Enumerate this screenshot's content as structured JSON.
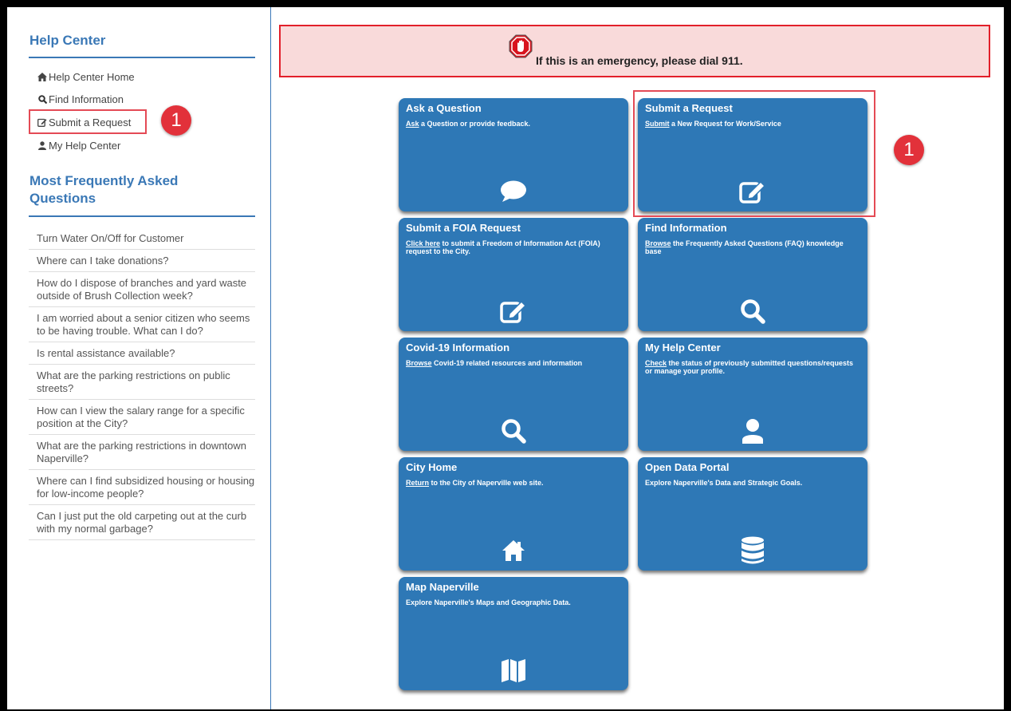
{
  "sidebar": {
    "title": "Help Center",
    "nav": [
      {
        "icon": "home-icon",
        "label": "Help Center Home"
      },
      {
        "icon": "search-icon",
        "label": "Find Information"
      },
      {
        "icon": "edit-icon",
        "label": "Submit a Request"
      },
      {
        "icon": "user-icon",
        "label": "My Help Center"
      }
    ],
    "badge": "1",
    "faq_title": "Most Frequently Asked Questions",
    "faq": [
      "Turn Water On/Off for Customer",
      "Where can I take donations?",
      "How do I dispose of branches and yard waste outside of Brush Collection week?",
      "I am worried about a senior citizen who seems to be having trouble. What can I do?",
      "Is rental assistance available?",
      "What are the parking restrictions on public streets?",
      "How can I view the salary range for a specific position at the City?",
      "What are the parking restrictions in downtown Naperville?",
      "Where can I find subsidized housing or housing for low-income people?",
      "Can I just put the old carpeting out at the curb with my normal garbage?"
    ]
  },
  "alert": {
    "text": "If this is an emergency, please dial 911.",
    "icon": "stop-hand-icon"
  },
  "tiles": [
    {
      "title": "Ask a Question",
      "link": "Ask",
      "desc": " a Question or provide feedback.",
      "icon": "comment-icon"
    },
    {
      "title": "Submit a Request",
      "link": "Submit",
      "desc": " a New Request for Work/Service",
      "icon": "edit-icon"
    },
    {
      "title": "Submit a FOIA Request",
      "link": "Click here",
      "desc": " to submit a Freedom of Information Act (FOIA) request to the City.",
      "icon": "edit-icon"
    },
    {
      "title": "Find Information",
      "link": "Browse",
      "desc": " the Frequently Asked Questions (FAQ) knowledge base",
      "icon": "search-icon"
    },
    {
      "title": "Covid-19 Information",
      "link": "Browse",
      "desc": " Covid-19 related resources and information",
      "icon": "search-icon"
    },
    {
      "title": "My Help Center",
      "link": "Check",
      "desc": " the status of previously submitted questions/requests or manage your profile.",
      "icon": "user-icon"
    },
    {
      "title": "City Home",
      "link": "Return",
      "desc": " to the City of Naperville web site.",
      "icon": "home-icon"
    },
    {
      "title": "Open Data Portal",
      "link": "",
      "desc": "Explore Naperville's Data and Strategic Goals.",
      "icon": "database-icon"
    },
    {
      "title": "Map Naperville",
      "link": "",
      "desc": "Explore Naperville's Maps and Geographic Data.",
      "icon": "map-icon"
    }
  ],
  "annotation_badge": "1",
  "colors": {
    "tile": "#2e78b6",
    "accent": "#3a78b6",
    "highlight": "#e44a55",
    "badge": "#e2313a",
    "alert_bg": "#f9dada",
    "alert_border": "#e21f2a"
  }
}
